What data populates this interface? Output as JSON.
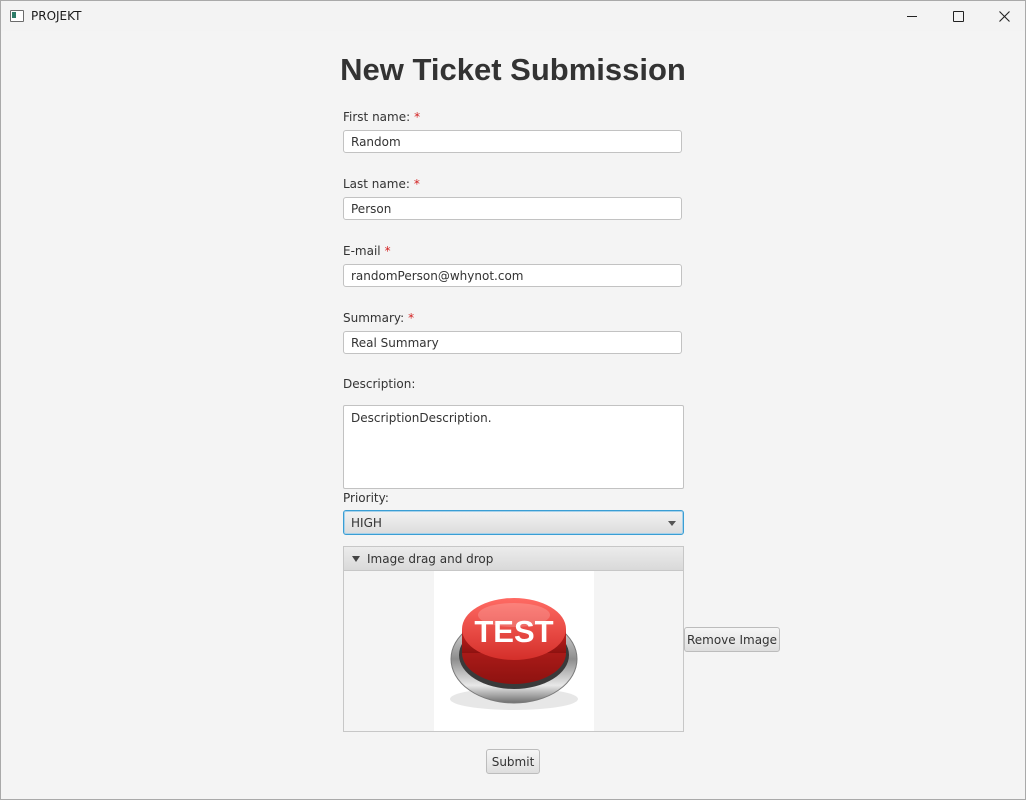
{
  "window": {
    "title": "PROJEKT",
    "controls": [
      "minimize",
      "maximize",
      "close"
    ]
  },
  "form": {
    "heading": "New Ticket Submission",
    "required_marker": "*",
    "first_name": {
      "label": "First name:",
      "value": "Random"
    },
    "last_name": {
      "label": "Last name:",
      "value": "Person"
    },
    "email": {
      "label": "E-mail",
      "value": "randomPerson@whynot.com"
    },
    "summary": {
      "label": "Summary:",
      "value": "Real Summary"
    },
    "description": {
      "label": "Description:",
      "value": "DescriptionDescription."
    },
    "priority": {
      "label": "Priority:",
      "value": "HIGH"
    },
    "image_dropzone": {
      "title": "Image drag and drop",
      "image_text": "TEST",
      "remove_label": "Remove Image"
    },
    "submit_label": "Submit"
  },
  "colors": {
    "required": "#d21f1f",
    "focus_border": "#3a9ed4",
    "button_red": "#e53935"
  }
}
